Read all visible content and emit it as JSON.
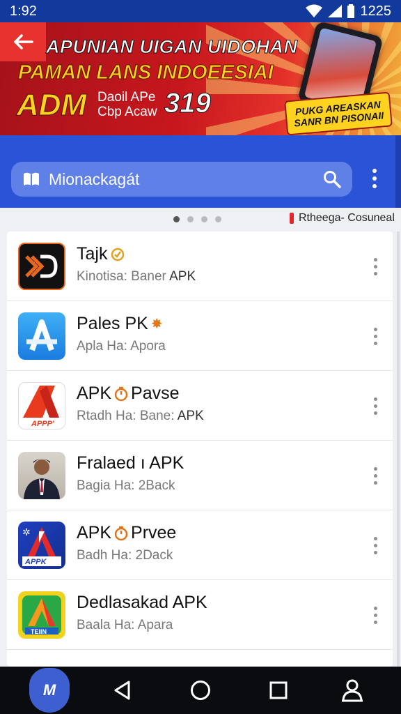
{
  "status_bar": {
    "time": "1:92",
    "right_time": "1225"
  },
  "banner": {
    "line1": "APUNIAN UIGAN UIDOHAN",
    "line2": "PAMAN LANS INDOEESIAI",
    "line3": "ADM",
    "line4a": "Daoil APe",
    "line4b": "Cbp Acaw",
    "line5": "319",
    "badge_line1": "PUKG AREASKAN",
    "badge_line2": "SANR BN PISONAII"
  },
  "search": {
    "placeholder": "Mionackagát"
  },
  "indicator": {
    "label": "Rtheega- Cosuneal",
    "pages": 4,
    "active_page": 1
  },
  "apps": [
    {
      "title": "Tajk",
      "badge": "",
      "subtitle": "Kinotisa: Baner",
      "subtitle_tag": "APK"
    },
    {
      "title": "Pales PK",
      "badge": "✸",
      "subtitle": "Apla Ha: Apora",
      "subtitle_tag": ""
    },
    {
      "title": "APK",
      "badge": "Pavse",
      "subtitle": "Rtadh Ha: Bane:",
      "subtitle_tag": "APK"
    },
    {
      "title": "Fralaed ı APK",
      "badge": "",
      "subtitle": "Bagia Ha: 2Back",
      "subtitle_tag": ""
    },
    {
      "title": "APK",
      "badge": "Prvee",
      "subtitle": "Badh Ha: 2Dack",
      "subtitle_tag": ""
    },
    {
      "title": "Dedlasakad APK",
      "badge": "",
      "subtitle": "Baala Ha: Apara",
      "subtitle_tag": ""
    }
  ],
  "icon_labels": {
    "app3": "APPP'",
    "app5": "APPK",
    "app6": "TEIIN"
  },
  "nav": {
    "launcher_label": "M"
  },
  "colors": {
    "status_bar": "#123a9c",
    "app_bar": "#2a53d6",
    "search_bg": "#5f80e6",
    "banner_red": "#c6171d",
    "banner_yellow": "#ffd21f"
  }
}
